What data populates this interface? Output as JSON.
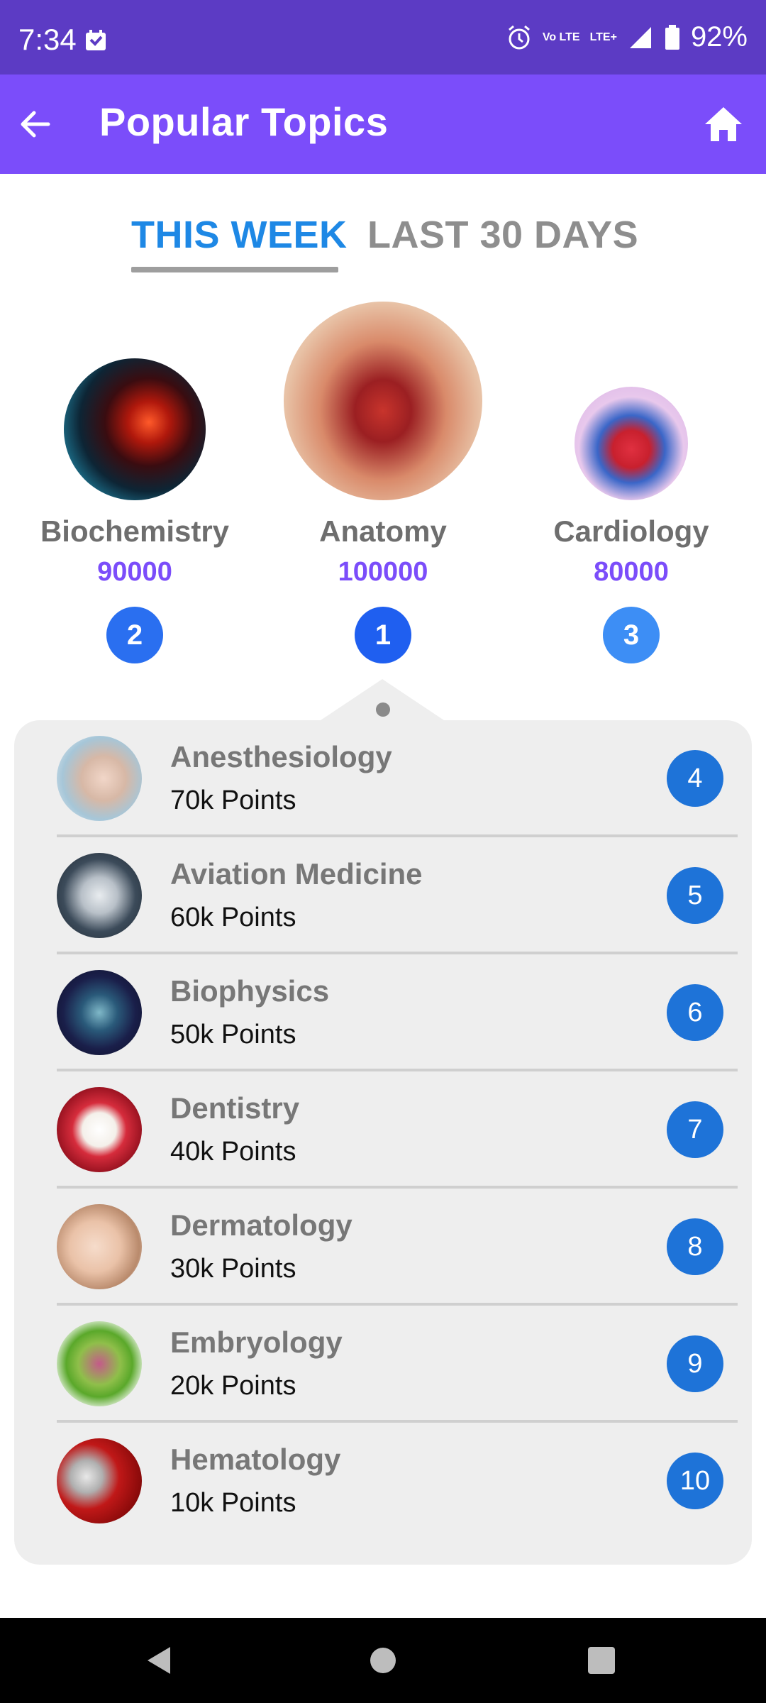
{
  "status_bar": {
    "time": "7:34",
    "network_label": "LTE+",
    "volte_label": "Vo LTE",
    "battery": "92%"
  },
  "app_bar": {
    "title": "Popular Topics",
    "back_icon": "arrow-left-icon",
    "home_icon": "home-icon"
  },
  "tabs": [
    {
      "label": "THIS WEEK",
      "active": true
    },
    {
      "label": "LAST 30 DAYS",
      "active": false
    }
  ],
  "podium": [
    {
      "name": "Biochemistry",
      "points": "90000",
      "rank": "2",
      "rank_color": "#2a6ff0"
    },
    {
      "name": "Anatomy",
      "points": "100000",
      "rank": "1",
      "rank_color": "#1f5ff0"
    },
    {
      "name": "Cardiology",
      "points": "80000",
      "rank": "3",
      "rank_color": "#3d8ef5"
    }
  ],
  "list": [
    {
      "name": "Anesthesiology",
      "points": "70k Points",
      "rank": "4"
    },
    {
      "name": "Aviation Medicine",
      "points": "60k Points",
      "rank": "5"
    },
    {
      "name": "Biophysics",
      "points": "50k Points",
      "rank": "6"
    },
    {
      "name": "Dentistry",
      "points": "40k Points",
      "rank": "7"
    },
    {
      "name": "Dermatology",
      "points": "30k Points",
      "rank": "8"
    },
    {
      "name": "Embryology",
      "points": "20k Points",
      "rank": "9"
    },
    {
      "name": "Hematology",
      "points": "10k Points",
      "rank": "10"
    }
  ],
  "colors": {
    "status_bar": "#5c3bc4",
    "app_bar": "#7b4dfa",
    "tab_active": "#1e88e5",
    "points_accent": "#7b4dfa",
    "list_rank": "#1e73d8"
  }
}
